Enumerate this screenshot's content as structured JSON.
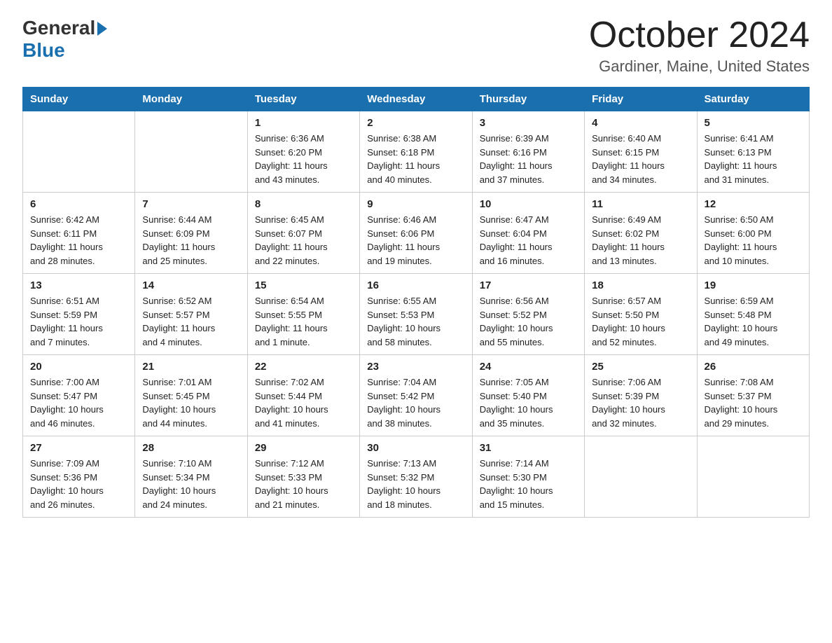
{
  "logo": {
    "general": "General",
    "blue": "Blue"
  },
  "title": {
    "month_year": "October 2024",
    "location": "Gardiner, Maine, United States"
  },
  "weekdays": [
    "Sunday",
    "Monday",
    "Tuesday",
    "Wednesday",
    "Thursday",
    "Friday",
    "Saturday"
  ],
  "weeks": [
    [
      {
        "day": "",
        "info": ""
      },
      {
        "day": "",
        "info": ""
      },
      {
        "day": "1",
        "info": "Sunrise: 6:36 AM\nSunset: 6:20 PM\nDaylight: 11 hours\nand 43 minutes."
      },
      {
        "day": "2",
        "info": "Sunrise: 6:38 AM\nSunset: 6:18 PM\nDaylight: 11 hours\nand 40 minutes."
      },
      {
        "day": "3",
        "info": "Sunrise: 6:39 AM\nSunset: 6:16 PM\nDaylight: 11 hours\nand 37 minutes."
      },
      {
        "day": "4",
        "info": "Sunrise: 6:40 AM\nSunset: 6:15 PM\nDaylight: 11 hours\nand 34 minutes."
      },
      {
        "day": "5",
        "info": "Sunrise: 6:41 AM\nSunset: 6:13 PM\nDaylight: 11 hours\nand 31 minutes."
      }
    ],
    [
      {
        "day": "6",
        "info": "Sunrise: 6:42 AM\nSunset: 6:11 PM\nDaylight: 11 hours\nand 28 minutes."
      },
      {
        "day": "7",
        "info": "Sunrise: 6:44 AM\nSunset: 6:09 PM\nDaylight: 11 hours\nand 25 minutes."
      },
      {
        "day": "8",
        "info": "Sunrise: 6:45 AM\nSunset: 6:07 PM\nDaylight: 11 hours\nand 22 minutes."
      },
      {
        "day": "9",
        "info": "Sunrise: 6:46 AM\nSunset: 6:06 PM\nDaylight: 11 hours\nand 19 minutes."
      },
      {
        "day": "10",
        "info": "Sunrise: 6:47 AM\nSunset: 6:04 PM\nDaylight: 11 hours\nand 16 minutes."
      },
      {
        "day": "11",
        "info": "Sunrise: 6:49 AM\nSunset: 6:02 PM\nDaylight: 11 hours\nand 13 minutes."
      },
      {
        "day": "12",
        "info": "Sunrise: 6:50 AM\nSunset: 6:00 PM\nDaylight: 11 hours\nand 10 minutes."
      }
    ],
    [
      {
        "day": "13",
        "info": "Sunrise: 6:51 AM\nSunset: 5:59 PM\nDaylight: 11 hours\nand 7 minutes."
      },
      {
        "day": "14",
        "info": "Sunrise: 6:52 AM\nSunset: 5:57 PM\nDaylight: 11 hours\nand 4 minutes."
      },
      {
        "day": "15",
        "info": "Sunrise: 6:54 AM\nSunset: 5:55 PM\nDaylight: 11 hours\nand 1 minute."
      },
      {
        "day": "16",
        "info": "Sunrise: 6:55 AM\nSunset: 5:53 PM\nDaylight: 10 hours\nand 58 minutes."
      },
      {
        "day": "17",
        "info": "Sunrise: 6:56 AM\nSunset: 5:52 PM\nDaylight: 10 hours\nand 55 minutes."
      },
      {
        "day": "18",
        "info": "Sunrise: 6:57 AM\nSunset: 5:50 PM\nDaylight: 10 hours\nand 52 minutes."
      },
      {
        "day": "19",
        "info": "Sunrise: 6:59 AM\nSunset: 5:48 PM\nDaylight: 10 hours\nand 49 minutes."
      }
    ],
    [
      {
        "day": "20",
        "info": "Sunrise: 7:00 AM\nSunset: 5:47 PM\nDaylight: 10 hours\nand 46 minutes."
      },
      {
        "day": "21",
        "info": "Sunrise: 7:01 AM\nSunset: 5:45 PM\nDaylight: 10 hours\nand 44 minutes."
      },
      {
        "day": "22",
        "info": "Sunrise: 7:02 AM\nSunset: 5:44 PM\nDaylight: 10 hours\nand 41 minutes."
      },
      {
        "day": "23",
        "info": "Sunrise: 7:04 AM\nSunset: 5:42 PM\nDaylight: 10 hours\nand 38 minutes."
      },
      {
        "day": "24",
        "info": "Sunrise: 7:05 AM\nSunset: 5:40 PM\nDaylight: 10 hours\nand 35 minutes."
      },
      {
        "day": "25",
        "info": "Sunrise: 7:06 AM\nSunset: 5:39 PM\nDaylight: 10 hours\nand 32 minutes."
      },
      {
        "day": "26",
        "info": "Sunrise: 7:08 AM\nSunset: 5:37 PM\nDaylight: 10 hours\nand 29 minutes."
      }
    ],
    [
      {
        "day": "27",
        "info": "Sunrise: 7:09 AM\nSunset: 5:36 PM\nDaylight: 10 hours\nand 26 minutes."
      },
      {
        "day": "28",
        "info": "Sunrise: 7:10 AM\nSunset: 5:34 PM\nDaylight: 10 hours\nand 24 minutes."
      },
      {
        "day": "29",
        "info": "Sunrise: 7:12 AM\nSunset: 5:33 PM\nDaylight: 10 hours\nand 21 minutes."
      },
      {
        "day": "30",
        "info": "Sunrise: 7:13 AM\nSunset: 5:32 PM\nDaylight: 10 hours\nand 18 minutes."
      },
      {
        "day": "31",
        "info": "Sunrise: 7:14 AM\nSunset: 5:30 PM\nDaylight: 10 hours\nand 15 minutes."
      },
      {
        "day": "",
        "info": ""
      },
      {
        "day": "",
        "info": ""
      }
    ]
  ]
}
